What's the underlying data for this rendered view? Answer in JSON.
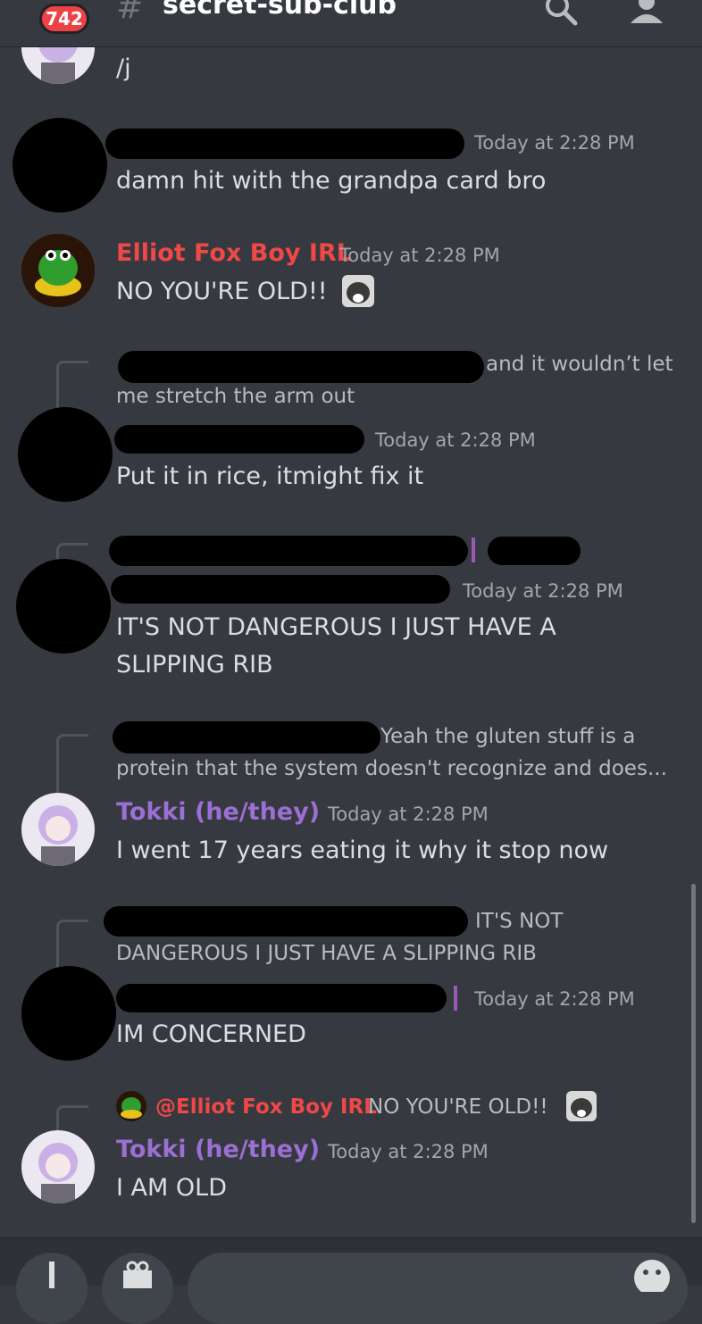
{
  "header": {
    "badge_count": "742",
    "channel_name": "secret-sub-club"
  },
  "messages": [
    {
      "continuation": "/j"
    },
    {
      "time": "Today at 2:28 PM",
      "text": "damn hit with the grandpa card bro"
    },
    {
      "author": "Elliot Fox Boy IRL",
      "author_color": "#f04747",
      "time": "Today at 2:28 PM",
      "text": "NO YOU'RE OLD!!"
    },
    {
      "reply_text": "and it wouldn’t let me stretch the arm out",
      "time": "Today at 2:28 PM",
      "text": "Put it in rice, itmight fix it"
    },
    {
      "time": "Today at 2:28 PM",
      "text": "IT'S NOT DANGEROUS I JUST HAVE A SLIPPING RIB"
    },
    {
      "reply_text": "Yeah the gluten stuff is a protein that the system doesn't recognize and does...",
      "author": "Tokki (he/they)",
      "author_color": "#9b6fd4",
      "time": "Today at 2:28 PM",
      "text": "I went 17 years eating it why it stop now"
    },
    {
      "reply_text": "IT'S NOT DANGEROUS I JUST HAVE A SLIPPING RIB",
      "time": "Today at 2:28 PM",
      "text": "IM CONCERNED"
    },
    {
      "reply_mention": "@Elliot Fox Boy IRL",
      "reply_text": "NO YOU'RE OLD!!",
      "author": "Tokki (he/they)",
      "author_color": "#9b6fd4",
      "time": "Today at 2:28 PM",
      "text": "I AM OLD"
    }
  ],
  "icons": {
    "search": "search-icon",
    "members": "members-icon",
    "add": "plus-icon",
    "gift": "gift-icon",
    "emoji": "emoji-icon"
  }
}
